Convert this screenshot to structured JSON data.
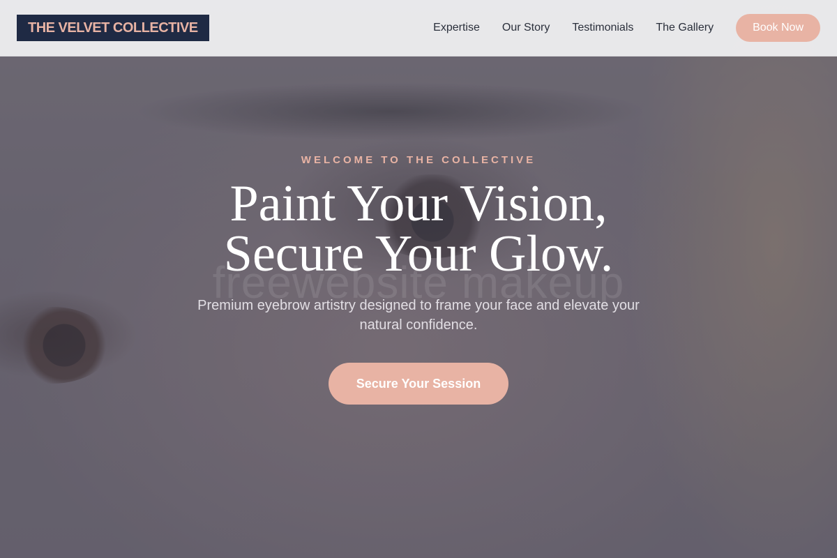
{
  "brand": {
    "logo_text": "THE VELVET COLLECTIVE"
  },
  "nav": {
    "links": [
      {
        "label": "Expertise"
      },
      {
        "label": "Our Story"
      },
      {
        "label": "Testimonials"
      },
      {
        "label": "The Gallery"
      }
    ],
    "cta_label": "Book Now"
  },
  "hero": {
    "eyebrow": "WELCOME TO THE COLLECTIVE",
    "headline_line1": "Paint Your Vision,",
    "headline_line2": "Secure Your Glow.",
    "subheadline": "Premium eyebrow artistry designed to frame your face and elevate your natural confidence.",
    "cta_label": "Secure Your Session",
    "watermark": "freewebsite makeup"
  },
  "colors": {
    "accent": "#e8b3a4",
    "logo_background": "#1f2a44",
    "nav_text": "#2a2f3b",
    "nav_background": "#ececee"
  }
}
